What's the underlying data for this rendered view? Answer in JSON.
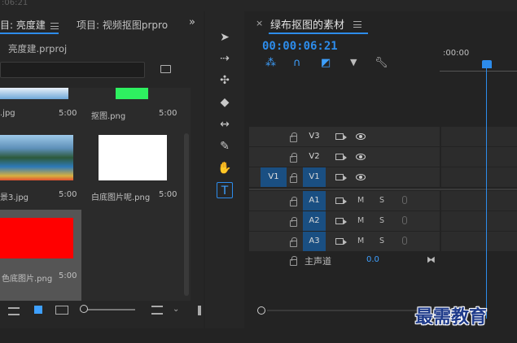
{
  "top": {
    "timecode_fragment": ":06:21"
  },
  "project_panel": {
    "tab_active": "目: 亮度建",
    "tab_other": "项目: 视频抠图prpro",
    "overflow": "»",
    "file_name": "亮度建.prproj",
    "items": [
      {
        "label": ".jpg",
        "duration": "5:00"
      },
      {
        "label": "抠图.png",
        "duration": "5:00"
      },
      {
        "label": "景3.jpg",
        "duration": "5:00"
      },
      {
        "label": "白底图片呢.png",
        "duration": "5:00"
      },
      {
        "label": "色底图片.png",
        "duration": "5:00"
      }
    ]
  },
  "timeline_panel": {
    "close": "×",
    "title": "绿布抠图的素材",
    "timecode": "00:00:06:21",
    "ruler_label": ":00:00",
    "video_tracks": [
      {
        "src": "",
        "name": "V3",
        "targeted": false
      },
      {
        "src": "",
        "name": "V2",
        "targeted": false
      },
      {
        "src": "V1",
        "name": "V1",
        "targeted": true
      }
    ],
    "audio_tracks": [
      {
        "name": "A1",
        "m": "M",
        "s": "S"
      },
      {
        "name": "A2",
        "m": "M",
        "s": "S"
      },
      {
        "name": "A3",
        "m": "M",
        "s": "S"
      }
    ],
    "master": {
      "label": "主声道",
      "value": "0.0"
    }
  },
  "watermark": "最需教育",
  "colors": {
    "accent": "#2d8ceb",
    "track_target": "#1a4f82"
  }
}
